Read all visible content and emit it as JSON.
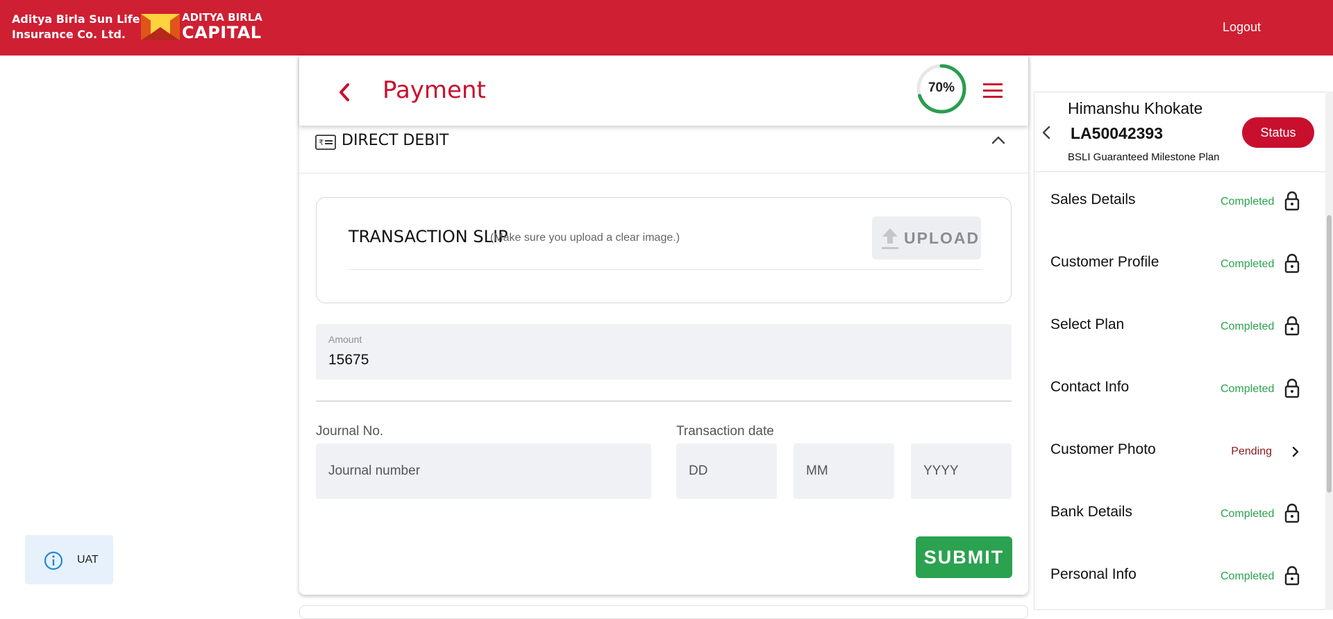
{
  "header": {
    "brand_line1": "Aditya Birla Sun Life",
    "brand_line2": "Insurance Co. Ltd.",
    "logo_line1": "ADITYA BIRLA",
    "logo_line2": "CAPITAL",
    "logout_label": "Logout",
    "bg_color": "#cf1f33"
  },
  "page": {
    "title": "Payment",
    "progress_label": "70%",
    "progress_fraction": 0.7
  },
  "payment_mode": {
    "label": "DIRECT DEBIT"
  },
  "transaction_slip": {
    "title": "TRANSACTION SLIP",
    "hint": "(Make sure you upload a clear image.)",
    "upload_label": "UPLOAD"
  },
  "amount": {
    "label": "Amount",
    "value": "15675"
  },
  "journal": {
    "label": "Journal No.",
    "placeholder": "Journal number"
  },
  "transaction_date": {
    "label": "Transaction date",
    "dd_placeholder": "DD",
    "mm_placeholder": "MM",
    "yyyy_placeholder": "YYYY"
  },
  "submit_label": "SUBMIT",
  "env_badge": {
    "label": "UAT"
  },
  "side_panel": {
    "customer_name": "Himanshu Khokate",
    "application_no": "LA50042393",
    "plan_name": "BSLI Guaranteed Milestone Plan",
    "status_button": "Status",
    "steps": [
      {
        "label": "Sales Details",
        "status": "Completed",
        "icon": "lock-icon"
      },
      {
        "label": "Customer Profile",
        "status": "Completed",
        "icon": "lock-icon"
      },
      {
        "label": "Select Plan",
        "status": "Completed",
        "icon": "lock-icon"
      },
      {
        "label": "Contact Info",
        "status": "Completed",
        "icon": "lock-icon"
      },
      {
        "label": "Customer Photo",
        "status": "Pending",
        "icon": "chevron-right-icon"
      },
      {
        "label": "Bank Details",
        "status": "Completed",
        "icon": "lock-icon"
      },
      {
        "label": "Personal Info",
        "status": "Completed",
        "icon": "lock-icon"
      }
    ]
  },
  "colors": {
    "accent_red": "#c8102e",
    "completed_green": "#2aa24f",
    "pending_red": "#8b1a1a"
  }
}
